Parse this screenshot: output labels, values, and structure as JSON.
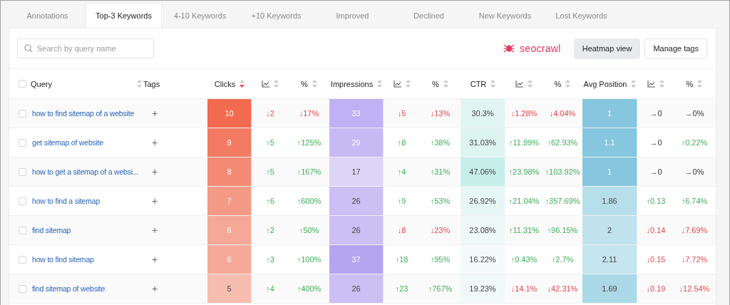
{
  "tabs": [
    {
      "label": "Annotations",
      "selected": false
    },
    {
      "label": "Top-3 Keywords",
      "selected": true
    },
    {
      "label": "4-10 Keywords",
      "selected": false
    },
    {
      "label": "+10 Keywords",
      "selected": false
    },
    {
      "label": "Improved",
      "selected": false
    },
    {
      "label": "Declined",
      "selected": false
    },
    {
      "label": "New Keywords",
      "selected": false
    },
    {
      "label": "Lost Keywords",
      "selected": false
    }
  ],
  "search": {
    "placeholder": "Search by query name"
  },
  "logo": {
    "text": "seocrawl"
  },
  "buttons": [
    {
      "label": "Heatmap view",
      "selected": true
    },
    {
      "label": "Manage tags",
      "selected": false
    }
  ],
  "table": {
    "header_checkbox": {
      "checked": false
    },
    "columns": [
      {
        "kind": "query",
        "label": "Query",
        "sorted_desc": false
      },
      {
        "kind": "tags",
        "label": "Tags"
      },
      {
        "kind": "metric",
        "label": "Clicks",
        "sorted_desc": true
      },
      {
        "kind": "trend",
        "sorted_desc": false
      },
      {
        "kind": "metric",
        "label": "%",
        "sorted_desc": false
      },
      {
        "kind": "metric",
        "label": "Impressions",
        "sorted_desc": false
      },
      {
        "kind": "trend",
        "sorted_desc": false
      },
      {
        "kind": "metric",
        "label": "%",
        "sorted_desc": false
      },
      {
        "kind": "metric",
        "label": "CTR",
        "sorted_desc": false
      },
      {
        "kind": "trend",
        "sorted_desc": false
      },
      {
        "kind": "metric",
        "label": "%",
        "sorted_desc": false
      },
      {
        "kind": "metric",
        "label": "Avg Position",
        "sorted_desc": false
      },
      {
        "kind": "trend",
        "sorted_desc": false
      },
      {
        "kind": "metric",
        "label": "%",
        "sorted_desc": false
      }
    ],
    "rows": [
      {
        "cells": [
          {
            "kind": "query",
            "text": "how to find sitemap of a website",
            "checked": false
          },
          {
            "kind": "tags",
            "text": "+"
          },
          {
            "kind": "heat",
            "text": "10",
            "color": "#f26a4f"
          },
          {
            "kind": "fall",
            "text": "↓2"
          },
          {
            "kind": "fall",
            "text": "↓17%"
          },
          {
            "kind": "heat",
            "text": "33",
            "color": "#bfb1f3"
          },
          {
            "kind": "fall",
            "text": "↓5"
          },
          {
            "kind": "fall",
            "text": "↓13%"
          },
          {
            "kind": "heat",
            "text": "30.3%",
            "color": "#e0f5f2"
          },
          {
            "kind": "fall",
            "text": "↓1.28%"
          },
          {
            "kind": "fall",
            "text": "↓4.04%"
          },
          {
            "kind": "heat",
            "text": "1",
            "color": "#86c6de"
          },
          {
            "kind": "steady",
            "text": "→0"
          },
          {
            "kind": "steady",
            "text": "→0%"
          }
        ]
      },
      {
        "cells": [
          {
            "kind": "query",
            "text": "get sitemap of website",
            "checked": false
          },
          {
            "kind": "tags",
            "text": "+"
          },
          {
            "kind": "heat",
            "text": "9",
            "color": "#f37b63"
          },
          {
            "kind": "rise",
            "text": "↑5"
          },
          {
            "kind": "rise",
            "text": "↑125%"
          },
          {
            "kind": "heat",
            "text": "29",
            "color": "#c7b9f4"
          },
          {
            "kind": "rise",
            "text": "↑8"
          },
          {
            "kind": "rise",
            "text": "↑38%"
          },
          {
            "kind": "heat",
            "text": "31.03%",
            "color": "#def4f1"
          },
          {
            "kind": "rise",
            "text": "↑11.99%"
          },
          {
            "kind": "rise",
            "text": "↑62.93%"
          },
          {
            "kind": "heat",
            "text": "1.1",
            "color": "#86c6de"
          },
          {
            "kind": "steady",
            "text": "→0"
          },
          {
            "kind": "rise",
            "text": "↑0.22%"
          }
        ]
      },
      {
        "cells": [
          {
            "kind": "query",
            "text": "how to get a sitemap of a websi...",
            "checked": false
          },
          {
            "kind": "tags",
            "text": "+"
          },
          {
            "kind": "heat",
            "text": "8",
            "color": "#f48a75"
          },
          {
            "kind": "rise",
            "text": "↑5"
          },
          {
            "kind": "rise",
            "text": "↑167%"
          },
          {
            "kind": "heat",
            "text": "17",
            "color": "#ddd5f7"
          },
          {
            "kind": "rise",
            "text": "↑4"
          },
          {
            "kind": "rise",
            "text": "↑31%"
          },
          {
            "kind": "heat",
            "text": "47.06%",
            "color": "#c6efea"
          },
          {
            "kind": "rise",
            "text": "↑23.98%"
          },
          {
            "kind": "rise",
            "text": "↑103.92%"
          },
          {
            "kind": "heat",
            "text": "1",
            "color": "#86c6de"
          },
          {
            "kind": "steady",
            "text": "→0"
          },
          {
            "kind": "steady",
            "text": "→0%"
          }
        ]
      },
      {
        "cells": [
          {
            "kind": "query",
            "text": "how to find a sitemap",
            "checked": false
          },
          {
            "kind": "tags",
            "text": "+"
          },
          {
            "kind": "heat",
            "text": "7",
            "color": "#f59a87"
          },
          {
            "kind": "rise",
            "text": "↑6"
          },
          {
            "kind": "rise",
            "text": "↑600%"
          },
          {
            "kind": "heat",
            "text": "26",
            "color": "#cbbff4"
          },
          {
            "kind": "rise",
            "text": "↑9"
          },
          {
            "kind": "rise",
            "text": "↑53%"
          },
          {
            "kind": "heat",
            "text": "26.92%",
            "color": "#e7f7f5"
          },
          {
            "kind": "rise",
            "text": "↑21.04%"
          },
          {
            "kind": "rise",
            "text": "↑357.69%"
          },
          {
            "kind": "heat",
            "text": "1.86",
            "color": "#b7dfeb"
          },
          {
            "kind": "rise",
            "text": "↑0.13"
          },
          {
            "kind": "rise",
            "text": "↑6.74%"
          }
        ]
      },
      {
        "cells": [
          {
            "kind": "query",
            "text": "find sitemap",
            "checked": false
          },
          {
            "kind": "tags",
            "text": "+"
          },
          {
            "kind": "heat",
            "text": "6",
            "color": "#f6a898"
          },
          {
            "kind": "rise",
            "text": "↑2"
          },
          {
            "kind": "rise",
            "text": "↑50%"
          },
          {
            "kind": "heat",
            "text": "26",
            "color": "#cbbff4"
          },
          {
            "kind": "fall",
            "text": "↓8"
          },
          {
            "kind": "fall",
            "text": "↓23%"
          },
          {
            "kind": "heat",
            "text": "23.08%",
            "color": "#eef8f7"
          },
          {
            "kind": "rise",
            "text": "↑11.31%"
          },
          {
            "kind": "rise",
            "text": "↑96.15%"
          },
          {
            "kind": "heat",
            "text": "2",
            "color": "#c0e2ec"
          },
          {
            "kind": "fall",
            "text": "↓0.14"
          },
          {
            "kind": "fall",
            "text": "↓7.69%"
          }
        ]
      },
      {
        "cells": [
          {
            "kind": "query",
            "text": "how to find sitemap",
            "checked": false
          },
          {
            "kind": "tags",
            "text": "+"
          },
          {
            "kind": "heat",
            "text": "6",
            "color": "#f6a898"
          },
          {
            "kind": "rise",
            "text": "↑3"
          },
          {
            "kind": "rise",
            "text": "↑100%"
          },
          {
            "kind": "heat",
            "text": "37",
            "color": "#b5a4f0"
          },
          {
            "kind": "rise",
            "text": "↑18"
          },
          {
            "kind": "rise",
            "text": "↑95%"
          },
          {
            "kind": "heat",
            "text": "16.22%",
            "color": "#f5fbfa"
          },
          {
            "kind": "rise",
            "text": "↑0.43%"
          },
          {
            "kind": "rise",
            "text": "↑2.7%"
          },
          {
            "kind": "heat",
            "text": "2.11",
            "color": "#c4e5ee"
          },
          {
            "kind": "fall",
            "text": "↓0.15"
          },
          {
            "kind": "fall",
            "text": "↓7.72%"
          }
        ]
      },
      {
        "cells": [
          {
            "kind": "query",
            "text": "find sitemap of website",
            "checked": false
          },
          {
            "kind": "tags",
            "text": "+"
          },
          {
            "kind": "heat",
            "text": "5",
            "color": "#f7bdb0"
          },
          {
            "kind": "rise",
            "text": "↑4"
          },
          {
            "kind": "rise",
            "text": "↑400%"
          },
          {
            "kind": "heat",
            "text": "26",
            "color": "#cbbff4"
          },
          {
            "kind": "rise",
            "text": "↑23"
          },
          {
            "kind": "rise",
            "text": "↑767%"
          },
          {
            "kind": "heat",
            "text": "19.23%",
            "color": "#f0f9f8"
          },
          {
            "kind": "fall",
            "text": "↓14.1%"
          },
          {
            "kind": "fall",
            "text": "↓42.31%"
          },
          {
            "kind": "heat",
            "text": "1.69",
            "color": "#abd9e7"
          },
          {
            "kind": "fall",
            "text": "↓0.19"
          },
          {
            "kind": "fall",
            "text": "↓12.54%"
          }
        ]
      }
    ]
  }
}
